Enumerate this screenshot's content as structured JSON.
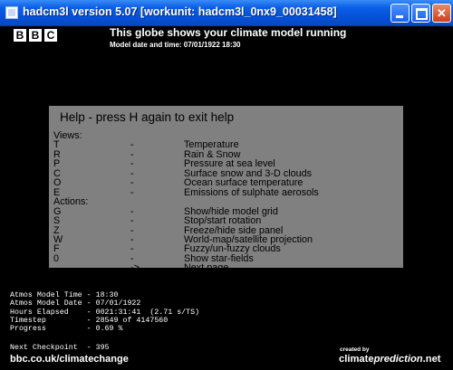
{
  "window": {
    "title": "hadcm3l version 5.07 [workunit: hadcm3l_0nx9_00031458]",
    "buttons": {
      "minimize": "minimize",
      "maximize": "maximize",
      "close": "✕"
    }
  },
  "header": {
    "logo_letters": [
      "B",
      "B",
      "C"
    ],
    "headline": "This globe shows your climate model running",
    "model_date_time": "Model date and time: 07/01/1922 18:30"
  },
  "help": {
    "title": "Help - press H again to exit help",
    "views_heading": "Views:",
    "actions_heading": "Actions:",
    "views": [
      {
        "key": "T",
        "sep": "-",
        "desc": "Temperature"
      },
      {
        "key": "R",
        "sep": "-",
        "desc": "Rain & Snow"
      },
      {
        "key": "P",
        "sep": "-",
        "desc": "Pressure at sea level"
      },
      {
        "key": "C",
        "sep": "-",
        "desc": "Surface snow and 3-D clouds"
      },
      {
        "key": "O",
        "sep": "-",
        "desc": "Ocean surface temperature"
      },
      {
        "key": "E",
        "sep": "-",
        "desc": "Emissions of sulphate aerosols"
      }
    ],
    "actions": [
      {
        "key": "G",
        "sep": "-",
        "desc": "Show/hide model grid"
      },
      {
        "key": "S",
        "sep": "-",
        "desc": "Stop/start rotation"
      },
      {
        "key": "Z",
        "sep": "-",
        "desc": "Freeze/hide side panel"
      },
      {
        "key": "W",
        "sep": "-",
        "desc": "World-map/satellite projection"
      },
      {
        "key": "F",
        "sep": "-",
        "desc": "Fuzzy/un-fuzzy clouds"
      },
      {
        "key": "0",
        "sep": "-",
        "desc": "Show star-fields"
      },
      {
        "key": "",
        "sep": "->",
        "desc": "Next page"
      }
    ]
  },
  "stats": [
    "Atmos Model Time - 18:30",
    "Atmos Model Date - 07/01/1922",
    "Hours Elapsed    - 0021:31:41  (2.71 s/TS)",
    "Timestep         - 28549 of 4147560",
    "Progress         - 0.69 %"
  ],
  "checkpoint": "Next Checkpoint  - 395",
  "footer": {
    "link": "bbc.co.uk/climatechange",
    "created_by": "created by",
    "cp_prefix": "climate",
    "cp_italic": "prediction",
    "cp_suffix": ".net"
  }
}
